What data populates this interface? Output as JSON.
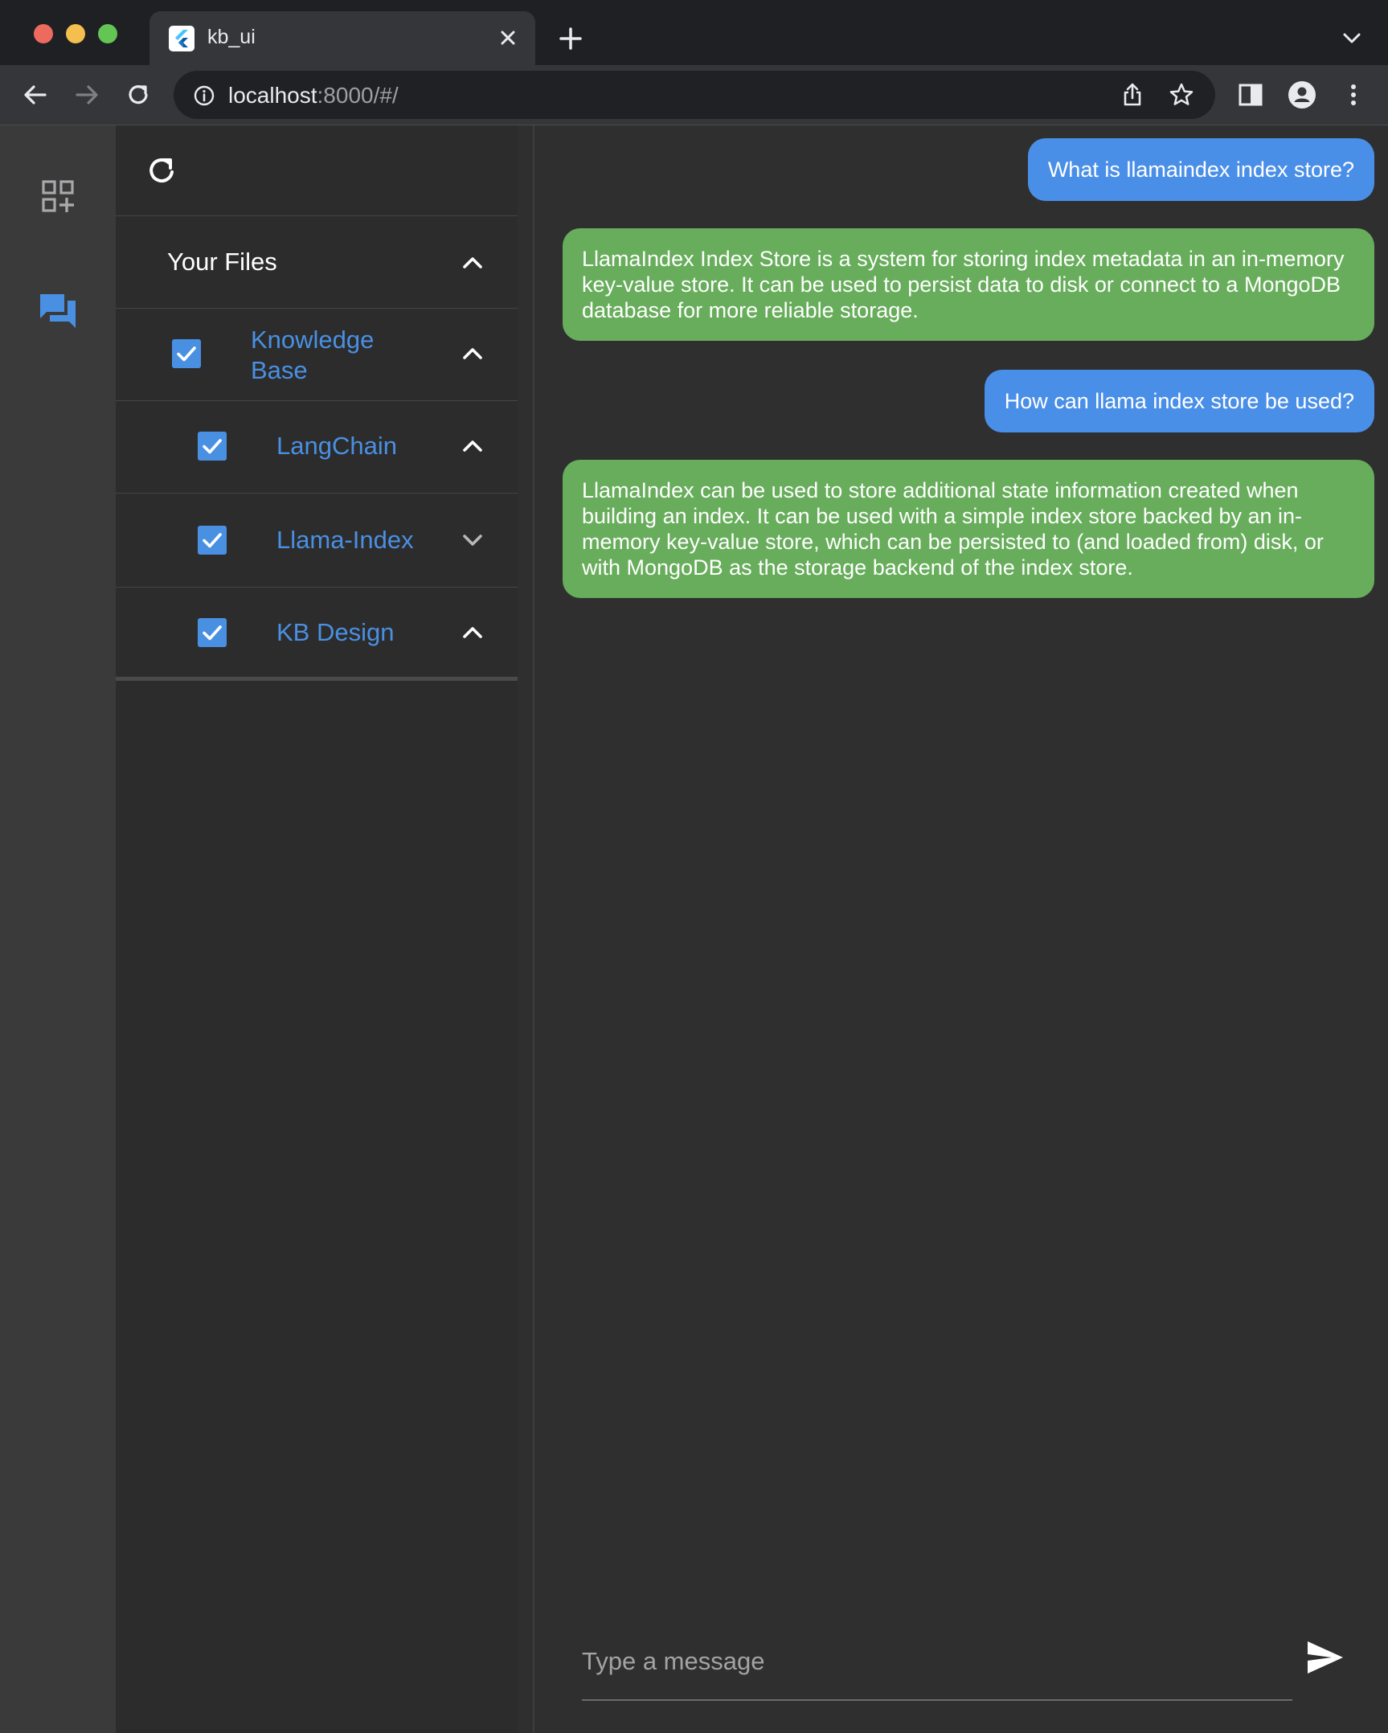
{
  "browser": {
    "tab_title": "kb_ui",
    "url_host": "localhost",
    "url_path": ":8000/#/"
  },
  "sidebar_rail": {
    "items": [
      {
        "icon": "add-widget-icon",
        "active": false
      },
      {
        "icon": "chat-icon",
        "active": true
      }
    ]
  },
  "files_panel": {
    "section_title": "Your Files",
    "nodes": [
      {
        "label": "Knowledge Base",
        "checked": true,
        "expanded": true
      },
      {
        "label": "LangChain",
        "checked": true,
        "expanded": true
      },
      {
        "label": "Llama-Index",
        "checked": true,
        "expanded": false
      },
      {
        "label": "KB Design",
        "checked": true,
        "expanded": true
      }
    ]
  },
  "chat": {
    "messages": [
      {
        "role": "user",
        "text": "What is llamaindex index store?"
      },
      {
        "role": "assistant",
        "text": "LlamaIndex Index Store is a system for storing index metadata in an in-memory key-value store. It can be used to persist data to disk or connect to a MongoDB database for more reliable storage."
      },
      {
        "role": "user",
        "text": "How can llama index store be used?"
      },
      {
        "role": "assistant",
        "text": "LlamaIndex can be used to store additional state information created when building an index. It can be used with a simple index store backed by an in-memory key-value store, which can be persisted to (and loaded from) disk, or with MongoDB as the storage backend of the index store."
      }
    ],
    "input": {
      "value": "",
      "placeholder": "Type a message"
    }
  },
  "colors": {
    "accent_blue": "#4a90e2",
    "user_bubble": "#4a8fe7",
    "assistant_bubble": "#67ad5b",
    "panel_bg": "#2c2c2d",
    "rail_bg": "#3a3a3b"
  }
}
